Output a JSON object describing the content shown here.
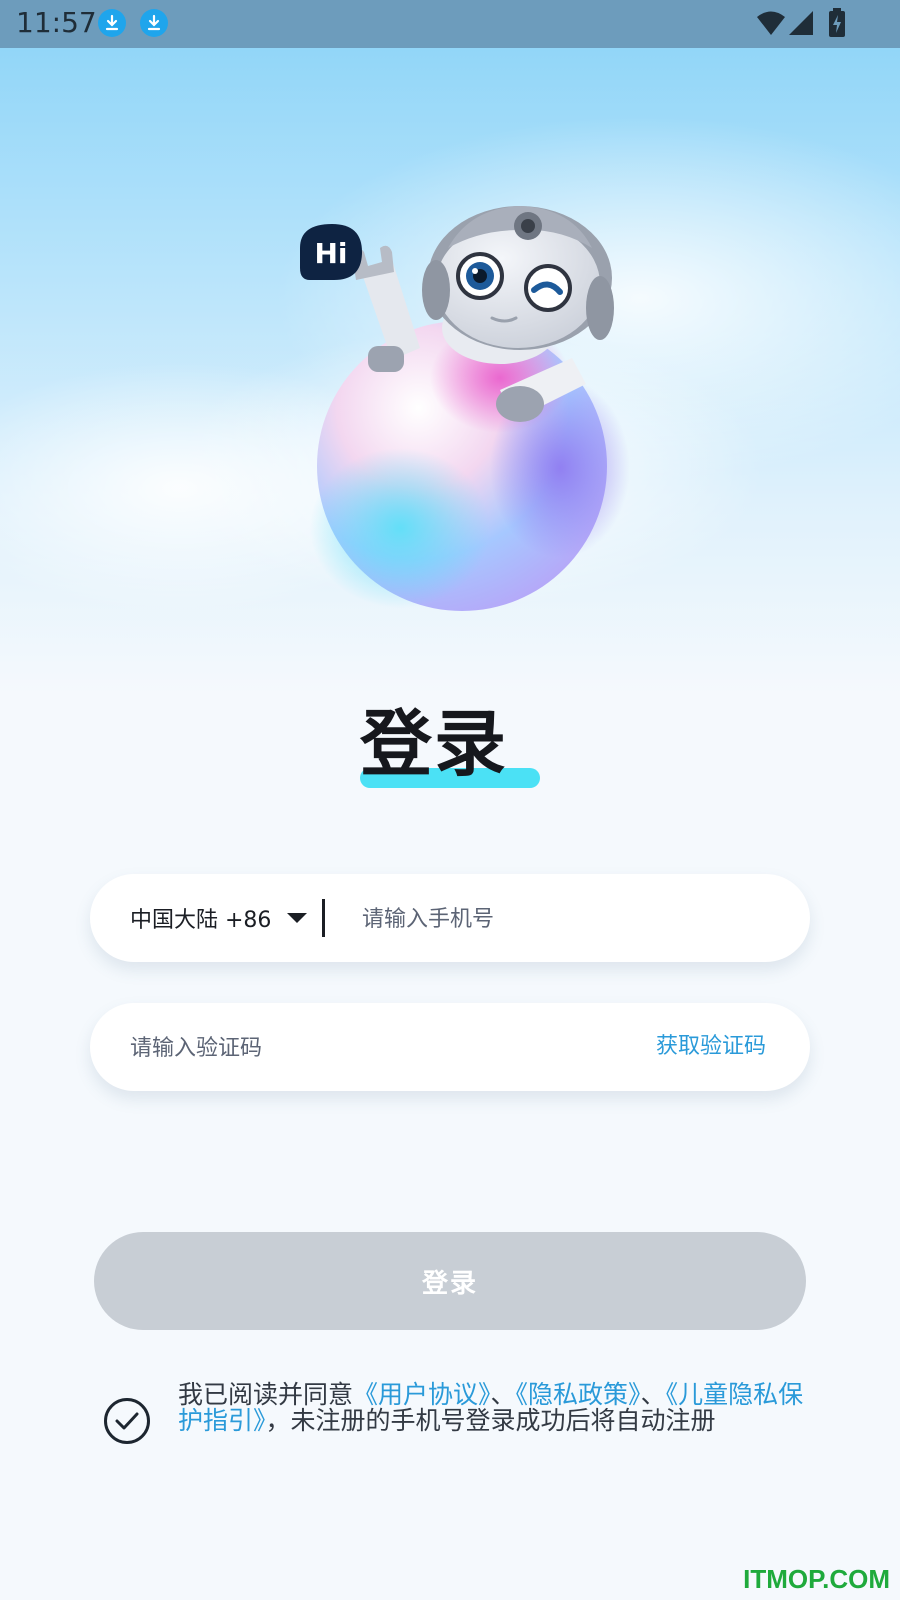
{
  "status_bar": {
    "time": "11:57",
    "icons": [
      "download-icon",
      "download-icon",
      "wifi-icon",
      "signal-icon",
      "battery-charging-icon"
    ]
  },
  "hero": {
    "bubble_text": "Hi"
  },
  "page_title": "登录",
  "phone_field": {
    "country_code": "中国大陆 +86",
    "placeholder": "请输入手机号"
  },
  "code_field": {
    "placeholder": "请输入验证码",
    "get_code_label": "获取验证码"
  },
  "login_button_label": "登录",
  "agreement": {
    "prefix": "我已阅读并同意",
    "user_agreement": "《用户协议》",
    "sep1": "、",
    "privacy_policy": "《隐私政策》",
    "sep2": "、",
    "child_privacy": "《儿童隐私保护指引》",
    "suffix": "，未注册的手机号登录成功后将自动注册"
  },
  "watermark": "ITMOP.COM",
  "colors": {
    "accent": "#2a9ad9",
    "title_underline": "#4be1f5",
    "button_disabled": "#c8ced5"
  }
}
